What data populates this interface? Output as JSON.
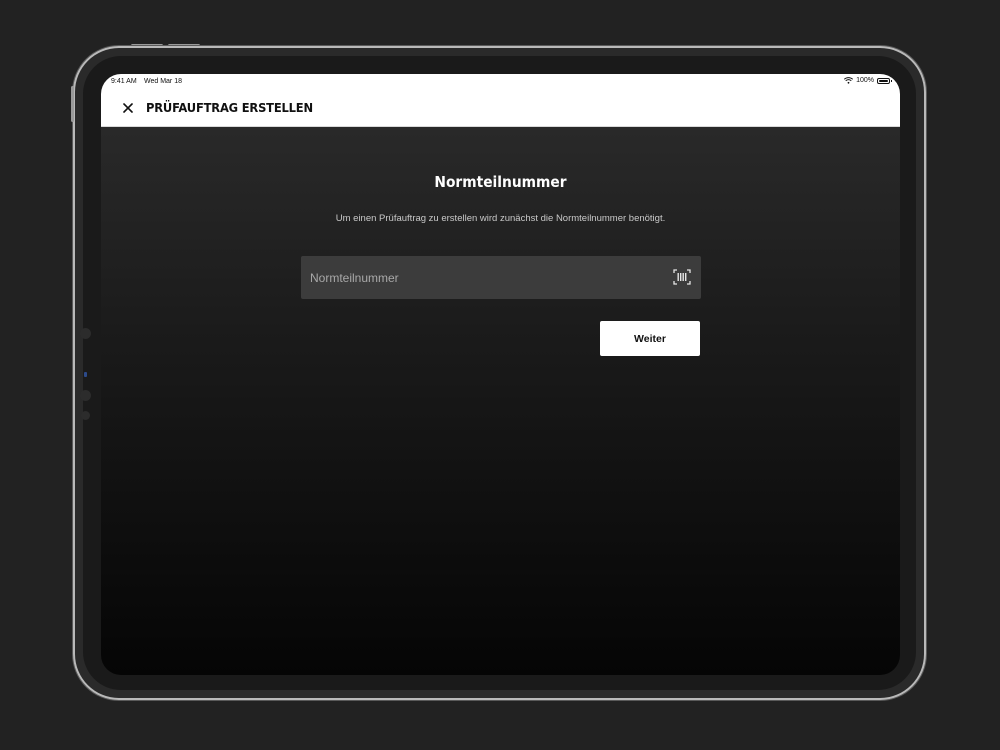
{
  "status_bar": {
    "time": "9:41 AM",
    "date": "Wed Mar 18",
    "battery": "100%"
  },
  "header": {
    "title": "PRÜFAUFTRAG ERSTELLEN",
    "close_icon": "close-icon"
  },
  "main": {
    "heading": "Normteilnummer",
    "description": "Um einen Prüfauftrag zu erstellen wird zunächst die Normteilnummer benötigt.",
    "input": {
      "placeholder": "Normteilnummer",
      "value": "",
      "scan_icon": "barcode-scan-icon"
    },
    "next_button_label": "Weiter"
  },
  "colors": {
    "background": "#222222",
    "header_bg": "#ffffff",
    "input_bg": "#3c3c3c",
    "button_bg": "#ffffff",
    "text_primary": "#ffffff",
    "text_secondary": "#c9c9c9"
  }
}
